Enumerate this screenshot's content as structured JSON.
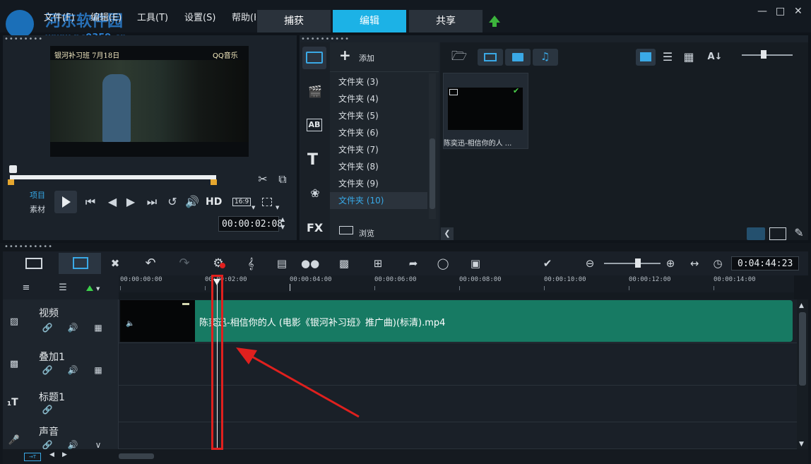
{
  "app": {
    "watermark_title": "河东软件园",
    "watermark_url": "www.pc0359.cn"
  },
  "menu": [
    "文件(F)",
    "编辑(E)",
    "工具(T)",
    "设置(S)",
    "帮助(H)"
  ],
  "tabs": [
    {
      "label": "捕获",
      "active": false
    },
    {
      "label": "编辑",
      "active": true
    },
    {
      "label": "共享",
      "active": false
    }
  ],
  "player": {
    "video_caption": "银河补习班  7月18日",
    "video_badge": "QQ音乐",
    "mode_project": "项目",
    "mode_clip": "素材",
    "hd_label": "HD",
    "aspect_label": "16:9",
    "timecode": "00:00:02:08"
  },
  "library": {
    "add_label": "添加",
    "browse_label": "浏览",
    "folders": [
      "文件夹 (3)",
      "文件夹 (4)",
      "文件夹 (5)",
      "文件夹 (6)",
      "文件夹 (7)",
      "文件夹 (8)",
      "文件夹 (9)",
      "文件夹 (10)"
    ],
    "selected_folder_index": 7,
    "clip_name": "陈奕迅-相信你的人 ..."
  },
  "timeline": {
    "total_time": "0:04:44:23",
    "ruler": [
      "00:00:00:00",
      "00:00:02:00",
      "00:00:04:00",
      "00:00:06:00",
      "00:00:08:00",
      "00:00:10:00",
      "00:00:12:00",
      "00:00:14:00"
    ],
    "tracks": [
      {
        "name": "视频"
      },
      {
        "name": "叠加1"
      },
      {
        "name": "标题1"
      },
      {
        "name": "声音"
      }
    ],
    "clip_title": "陈奕迅-相信你的人 (电影《银河补习班》推广曲)(标清).mp4"
  },
  "colors": {
    "accent": "#1cb2e6",
    "clip_green": "#177a63",
    "annotation_red": "#e0201e"
  }
}
